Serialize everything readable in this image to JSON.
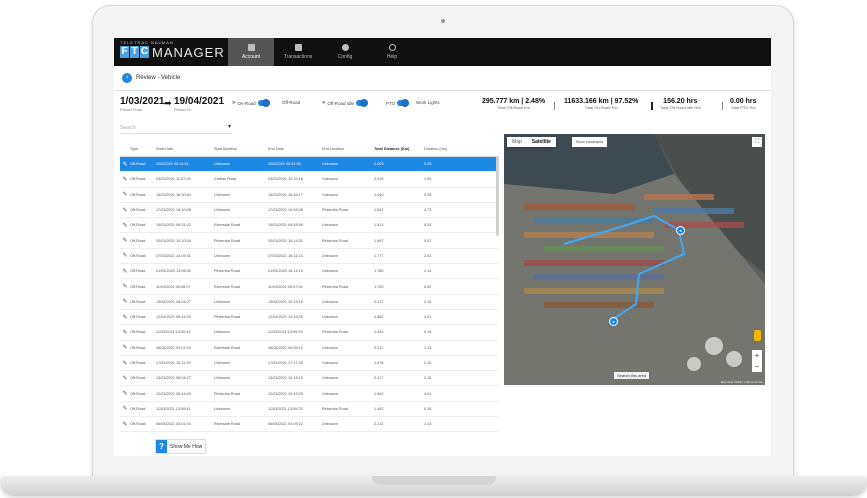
{
  "app": {
    "brand_top": "TELETRAC NAVMAN",
    "brand_letters": [
      "F",
      "T",
      "C"
    ],
    "brand_name": "MANAGER",
    "accent_color": "#1e88e5"
  },
  "nav": [
    {
      "label": "Account",
      "icon": "document-icon",
      "active": true
    },
    {
      "label": "Transactions",
      "icon": "transactions-icon",
      "active": false
    },
    {
      "label": "Config",
      "icon": "gear-icon",
      "active": false
    },
    {
      "label": "Help",
      "icon": "help-icon",
      "active": false
    }
  ],
  "breadcrumb": {
    "icon": "back-icon",
    "text": "Review - Vehicle"
  },
  "period": {
    "from_date": "1/03/2021",
    "from_label": "Period From",
    "to_date": "19/04/2021",
    "to_label": "Period To"
  },
  "toggles": [
    {
      "label": "On-Road",
      "on": true
    },
    {
      "label": "Off-Road",
      "on": false
    },
    {
      "label": "Off-Road Idle",
      "on": true
    },
    {
      "label": "PTO",
      "on": true
    },
    {
      "label": "Work Lights",
      "on": false
    }
  ],
  "stats": [
    {
      "value": "295.777 km | 2.48%",
      "label": "Total Off-Road Km"
    },
    {
      "value": "11633.166 km | 97.52%",
      "label": "Total On-Road Km"
    },
    {
      "value": "156.20 hrs",
      "label": "Total Off-Road Idle Hrs"
    },
    {
      "value": "0.00 hrs",
      "label": "Total PTO Hrs"
    }
  ],
  "search": {
    "placeholder": "Search"
  },
  "table": {
    "columns": [
      "Type",
      "Start Date",
      "Start Address",
      "End Date",
      "End Location",
      "Total Distance (Km)",
      "Duration (hrs)"
    ],
    "rows": [
      {
        "selected": true,
        "cells": [
          "Off-Road",
          "1/03/2021 00:14:11",
          "Unknown",
          "1/03/2021 00:31:26",
          "Unknown",
          "2.003",
          "0.29"
        ]
      },
      {
        "selected": false,
        "cells": [
          "Off-Road",
          "03/03/2021 11:07:03",
          "Civilian Road",
          "03/03/2021 12:10:16",
          "Unknown",
          "2.015",
          "1.05"
        ]
      },
      {
        "selected": false,
        "cells": [
          "Off-Road",
          "15/03/2021 16:30:54",
          "Unknown",
          "15/03/2021 16:46:17",
          "Unknown",
          "1.440",
          "0.26"
        ]
      },
      {
        "selected": false,
        "cells": [
          "Off-Road",
          "17/03/2021 15:10:08",
          "Unknown",
          "17/03/2021 19:53:48",
          "Pinkenba Road",
          "1.641",
          "4.73"
        ]
      },
      {
        "selected": false,
        "cells": [
          "Off-Road",
          "19/03/2021 09:31:22",
          "Riverside Road",
          "19/03/2021 09:45:56",
          "Unknown",
          "1.913",
          "0.24"
        ]
      },
      {
        "selected": false,
        "cells": [
          "Off-Road",
          "20/03/2021 10:10:34",
          "Pinkenba Road",
          "20/03/2021 10:14:31",
          "Pinkenba Road",
          "1.697",
          "0.07"
        ]
      },
      {
        "selected": false,
        "cells": [
          "Off-Road",
          "27/03/2021 14:09:31",
          "Unknown",
          "27/03/2021 16:11:13",
          "Unknown",
          "1.777",
          "2.03"
        ]
      },
      {
        "selected": false,
        "cells": [
          "Off-Road",
          "01/04/2021 13:06:00",
          "Pinkenba Road",
          "01/04/2021 15:14:15",
          "Unknown",
          "1.780",
          "2.14"
        ]
      },
      {
        "selected": false,
        "cells": [
          "Off-Road",
          "11/04/2021 05:06:07",
          "Riverside Road",
          "11/04/2021 05:07:04",
          "Pinkenba Road",
          "1.729",
          "0.02"
        ]
      },
      {
        "selected": false,
        "cells": [
          "Off-Road",
          "13/04/2021 08:04:27",
          "Unknown",
          "13/04/2021 10:13:19",
          "Unknown",
          "2.217",
          "2.15"
        ]
      },
      {
        "selected": false,
        "cells": [
          "Off-Road",
          "12/04/2021 06:44:03",
          "Pinkenba Road",
          "12/04/2021 10:43:25",
          "Unknown",
          "1.662",
          "4.01"
        ]
      },
      {
        "selected": false,
        "cells": [
          "Off-Road",
          "11/03/2021 13:00:41",
          "Unknown",
          "11/03/2021 13:09:25",
          "Pinkenba Road",
          "1.442",
          "0.15"
        ]
      },
      {
        "selected": false,
        "cells": [
          "Off-Road",
          "06/04/2021 03:01:04",
          "Riverside Road",
          "06/04/2021 04:09:12",
          "Unknown",
          "2.212",
          "1.13"
        ]
      },
      {
        "selected": false,
        "cells": [
          "Off-Road",
          "17/04/2021 15:11:29",
          "Unknown",
          "17/04/2021 17:17:26",
          "Unknown",
          "1.678",
          "2.10"
        ]
      },
      {
        "selected": false,
        "cells": [
          "Off-Road",
          "13/03/2021 08:04:27",
          "Unknown",
          "13/03/2021 10:13:19",
          "Unknown",
          "2.217",
          "2.15"
        ]
      },
      {
        "selected": false,
        "cells": [
          "Off-Road",
          "12/03/2021 06:44:03",
          "Pinkenba Road",
          "12/03/2021 10:43:25",
          "Unknown",
          "1.662",
          "4.01"
        ]
      },
      {
        "selected": false,
        "cells": [
          "Off-Road",
          "11/03/2021 13:00:41",
          "Unknown",
          "11/03/2021 13:09:25",
          "Pinkenba Road",
          "1.442",
          "0.15"
        ]
      },
      {
        "selected": false,
        "cells": [
          "Off-Road",
          "06/04/2021 03:01:04",
          "Riverside Road",
          "06/04/2021 04:09:12",
          "Unknown",
          "2.212",
          "1.13"
        ]
      },
      {
        "selected": false,
        "cells": [
          "Off-Road",
          "17/04/2021 15:11:29",
          "Unknown",
          "17/04/2021 17:17:26",
          "Unknown",
          "1.678",
          "2.10"
        ]
      }
    ]
  },
  "show_me_how": {
    "icon": "help-icon",
    "label": "Show Me How"
  },
  "map": {
    "map_label": "Map",
    "satellite_label": "Satellite",
    "active": "Satellite",
    "checkbox_label": "Show Landmarks",
    "search_area_label": "Search this area",
    "zoom_in": "+",
    "zoom_out": "−",
    "attribution": "Map data ©2021 | Terms of Use",
    "route_color": "#3fa9f5"
  }
}
